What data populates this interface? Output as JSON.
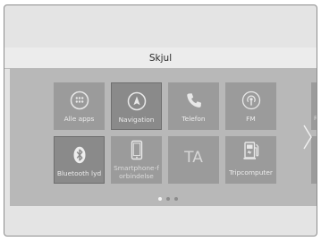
{
  "header": {
    "title": "Skjul"
  },
  "tiles": {
    "alle_apps": {
      "label": "Alle apps",
      "icon": "grid-icon"
    },
    "navigation": {
      "label": "Navigation",
      "icon": "compass-icon"
    },
    "telefon": {
      "label": "Telefon",
      "icon": "phone-icon"
    },
    "fm": {
      "label": "FM",
      "icon": "radio-icon"
    },
    "bluetooth": {
      "label": "Bluetooth lyd",
      "icon": "bluetooth-icon"
    },
    "smartphone": {
      "label_line1": "Smartphone-f",
      "label_line2": "orbindelse",
      "icon": "smartphone-icon"
    },
    "ta": {
      "label": "TA"
    },
    "tripcomputer": {
      "label": "Tripcomputer",
      "icon": "fuel-pump-icon"
    }
  },
  "peek": {
    "top_text": "Ra"
  },
  "pagination": {
    "pages": 3,
    "current": 1
  },
  "colors": {
    "panel": "#b8b8b8",
    "tile": "#9b9b9b",
    "tile_selected": "#8a8a8a"
  }
}
